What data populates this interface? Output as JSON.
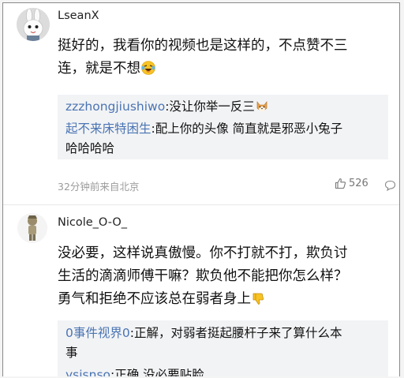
{
  "comments": [
    {
      "username": "LseanX",
      "text_lines": [
        "挺好的，我看你的视频也是这样的，不点赞不三",
        "连，就是不想"
      ],
      "emoji": "laughing-crying-emoji",
      "replies": [
        {
          "name": "zzzhongjiushiwo",
          "text": ":没让你举一反三",
          "emoji": "shiba-dog-emoji"
        },
        {
          "name": "起不来床特困生",
          "text": ":配上你的头像 简直就是邪恶小兔子",
          "text2": "哈哈哈哈"
        }
      ],
      "time_location": "32分钟前来自北京",
      "like_count": "526",
      "icons": {
        "like": "thumbs-up-icon",
        "comment": "comment-bubble-icon"
      }
    },
    {
      "username": "Nicole_O-O_",
      "text_lines": [
        "没必要，这样说真傲慢。你不打就不打，欺负讨",
        "生活的滴滴师傅干嘛？欺负他不能把你怎么样？",
        "勇气和拒绝不应该总在弱者身上"
      ],
      "emoji": "thumbs-down-emoji",
      "replies": [
        {
          "name": "0事件视界0",
          "text": ":正解，对弱者挺起腰杆子来了算什么本",
          "text2": "事"
        },
        {
          "name": "ysisnso",
          "text": ":正确 没必要贴脸"
        }
      ]
    }
  ],
  "colors": {
    "reply_name": "#4a74b3",
    "reply_bg": "#f2f3f5",
    "meta": "#9b9b9b"
  }
}
